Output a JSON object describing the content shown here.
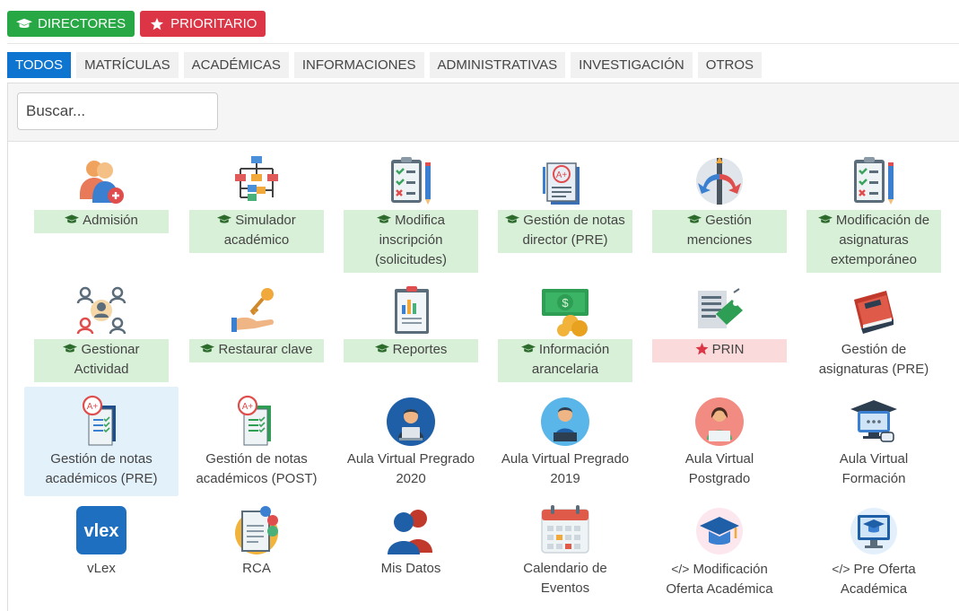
{
  "badges": {
    "directores": "DIRECTORES",
    "prioritario": "PRIORITARIO"
  },
  "tabs": [
    "TODOS",
    "MATRÍCULAS",
    "ACADÉMICAS",
    "INFORMACIONES",
    "ADMINISTRATIVAS",
    "INVESTIGACIÓN",
    "OTROS"
  ],
  "search": {
    "placeholder": "Buscar..."
  },
  "items": [
    {
      "label": "Admisión"
    },
    {
      "label": "Simulador académico"
    },
    {
      "label": "Modifica inscripción (solicitudes)"
    },
    {
      "label": "Gestión de notas director (PRE)"
    },
    {
      "label": "Gestión menciones"
    },
    {
      "label": "Modificación de asignaturas extemporáneo"
    },
    {
      "label": "Gestionar Actividad"
    },
    {
      "label": "Restaurar clave"
    },
    {
      "label": "Reportes"
    },
    {
      "label": "Información arancelaria"
    },
    {
      "label": "PRIN"
    },
    {
      "label": "Gestión de asignaturas (PRE)"
    },
    {
      "label": "Gestión de notas académicos (PRE)"
    },
    {
      "label": "Gestión de notas académicos (POST)"
    },
    {
      "label": "Aula Virtual Pregrado 2020"
    },
    {
      "label": "Aula Virtual Pregrado 2019"
    },
    {
      "label": "Aula Virtual Postgrado"
    },
    {
      "label": "Aula Virtual Formación"
    },
    {
      "label": "vLex"
    },
    {
      "label": "RCA"
    },
    {
      "label": "Mis Datos"
    },
    {
      "label": "Calendario de Eventos"
    },
    {
      "label": "Modificación Oferta Académica"
    },
    {
      "label": "Pre Oferta Académica"
    }
  ],
  "code_prefix": "</>",
  "vlex_text": "vlex",
  "colors": {
    "green": "#28a745",
    "red": "#dc3545",
    "tab_active": "#0d74d0",
    "label_green_bg": "#d8f0d8",
    "label_red_bg": "#fadada"
  }
}
